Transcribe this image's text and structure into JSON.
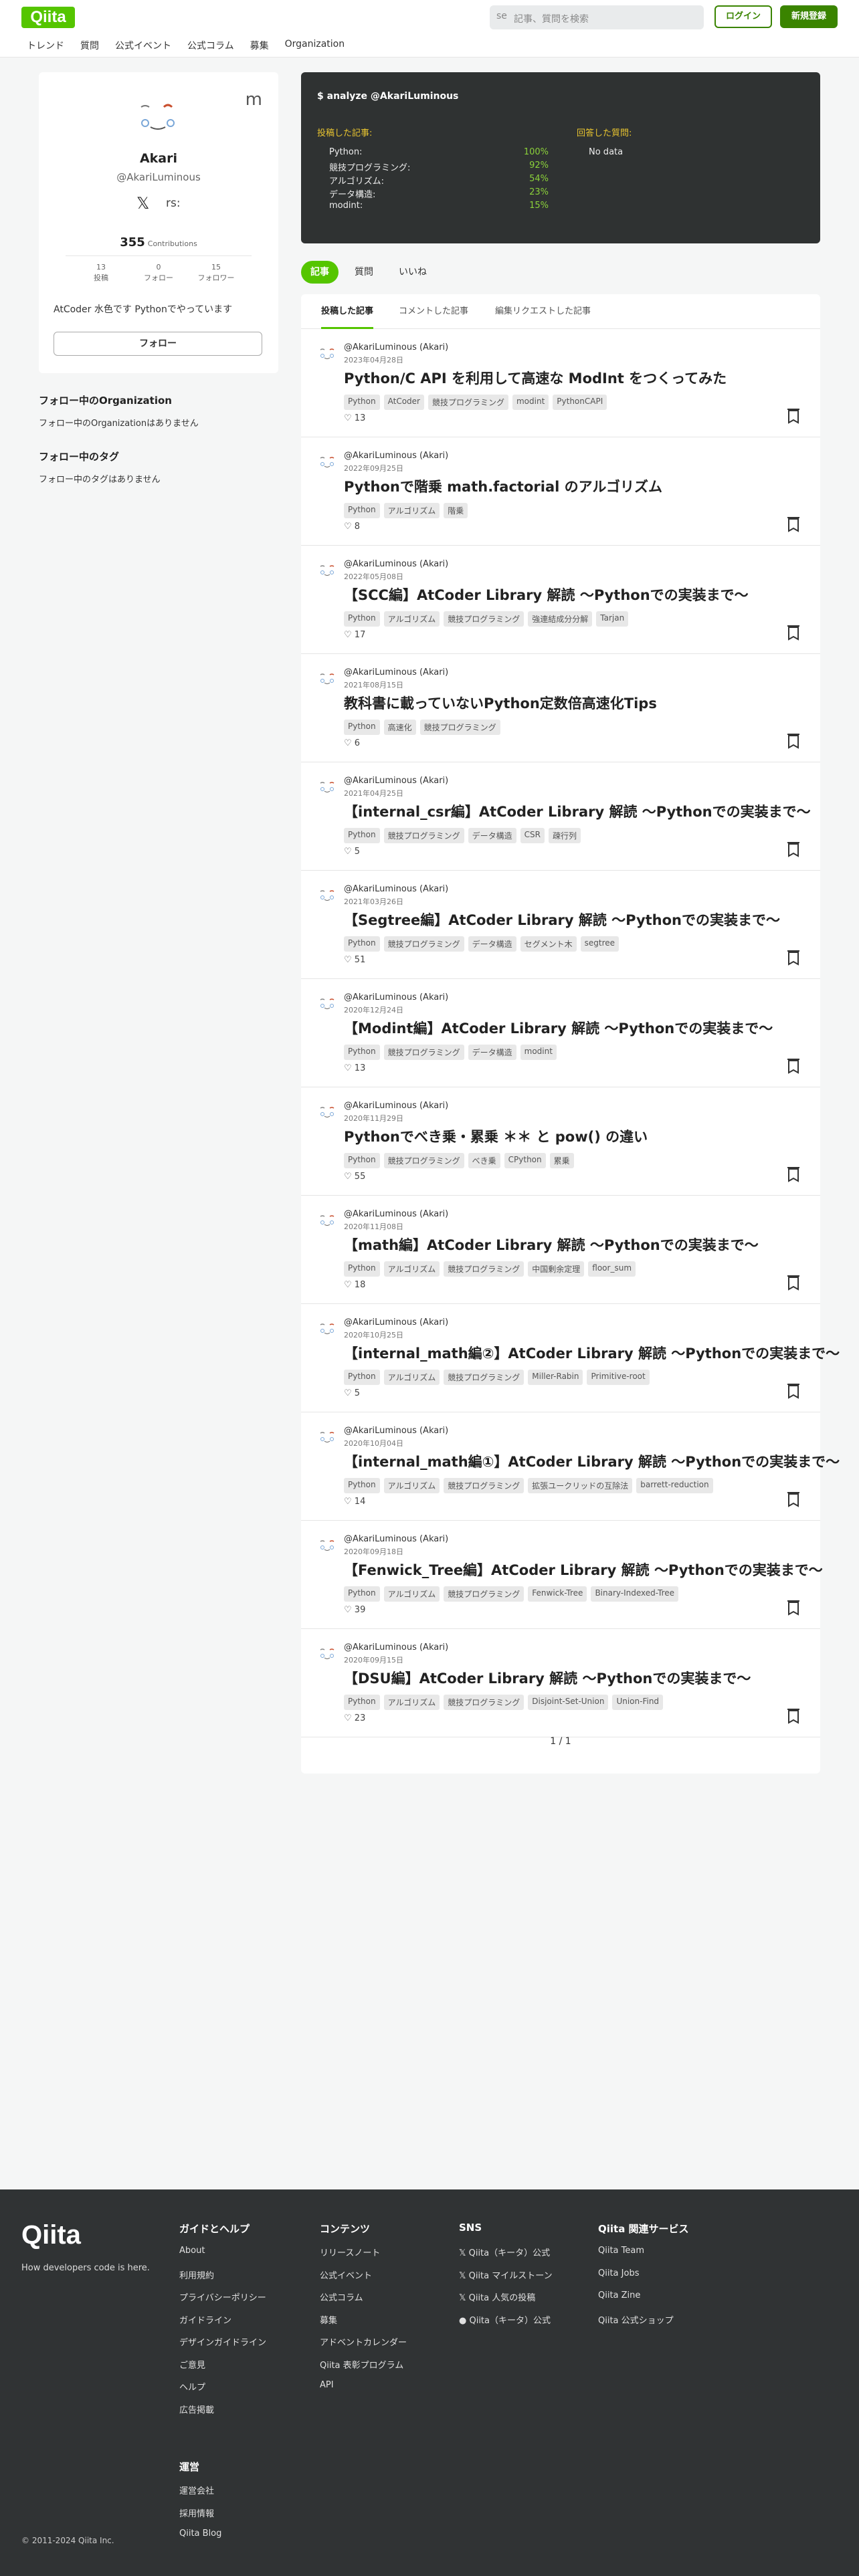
{
  "header": {
    "logo": "Qiita",
    "search_icon_glyph": "se",
    "search_placeholder": "記事、質問を検索",
    "login": "ログイン",
    "signup": "新規登録",
    "nav": [
      "トレンド",
      "質問",
      "公式イベント",
      "公式コラム",
      "募集",
      "Organization"
    ]
  },
  "profile": {
    "m_glyph": "m",
    "name": "Akari",
    "handle": "@AkariLuminous",
    "x_glyph": "𝕏",
    "rss_glyph": "rs:",
    "contributions": "355",
    "contributions_label": "Contributions",
    "stats": [
      {
        "value": "13",
        "label": "投稿"
      },
      {
        "value": "0",
        "label": "フォロー"
      },
      {
        "value": "15",
        "label": "フォロワー"
      }
    ],
    "bio": "AtCoder 水色です Pythonでやっています",
    "follow": "フォロー"
  },
  "sidebar": {
    "org_heading": "フォロー中のOrganization",
    "org_empty": "フォロー中のOrganizationはありません",
    "tag_heading": "フォロー中のタグ",
    "tag_empty": "フォロー中のタグはありません"
  },
  "analyze": {
    "title": "$ analyze @AkariLuminous",
    "posted_heading": "投稿した記事:",
    "answered_heading": "回答した質問:",
    "answered_empty": "No data",
    "rows": [
      {
        "label": "Python:",
        "pct": "100%"
      },
      {
        "label": "競技プログラミング:",
        "pct": "92%"
      },
      {
        "label": "アルゴリズム:",
        "pct": "54%"
      },
      {
        "label": "データ構造:",
        "pct": "23%"
      },
      {
        "label": "modint:",
        "pct": "15%"
      }
    ]
  },
  "tabs": [
    "記事",
    "質問",
    "いいね"
  ],
  "subtabs": [
    "投稿した記事",
    "コメントした記事",
    "編集リクエストした記事"
  ],
  "articles": [
    {
      "author": "@AkariLuminous (Akari)",
      "date": "2023年04月28日",
      "title": "Python/C API を利用して高速な ModInt をつくってみた",
      "tags": [
        "Python",
        "AtCoder",
        "競技プログラミング",
        "modint",
        "PythonCAPI"
      ],
      "likes": "13"
    },
    {
      "author": "@AkariLuminous (Akari)",
      "date": "2022年09月25日",
      "title": "Pythonで階乗 math.factorial のアルゴリズム",
      "tags": [
        "Python",
        "アルゴリズム",
        "階乗"
      ],
      "likes": "8"
    },
    {
      "author": "@AkariLuminous (Akari)",
      "date": "2022年05月08日",
      "title": "【SCC編】AtCoder Library 解読 〜Pythonでの実装まで〜",
      "tags": [
        "Python",
        "アルゴリズム",
        "競技プログラミング",
        "強連結成分分解",
        "Tarjan"
      ],
      "likes": "17"
    },
    {
      "author": "@AkariLuminous (Akari)",
      "date": "2021年08月15日",
      "title": "教科書に載っていないPython定数倍高速化Tips",
      "tags": [
        "Python",
        "高速化",
        "競技プログラミング"
      ],
      "likes": "6"
    },
    {
      "author": "@AkariLuminous (Akari)",
      "date": "2021年04月25日",
      "title": "【internal_csr編】AtCoder Library 解読 〜Pythonでの実装まで〜",
      "tags": [
        "Python",
        "競技プログラミング",
        "データ構造",
        "CSR",
        "疎行列"
      ],
      "likes": "5"
    },
    {
      "author": "@AkariLuminous (Akari)",
      "date": "2021年03月26日",
      "title": "【Segtree編】AtCoder Library 解読 〜Pythonでの実装まで〜",
      "tags": [
        "Python",
        "競技プログラミング",
        "データ構造",
        "セグメント木",
        "segtree"
      ],
      "likes": "51"
    },
    {
      "author": "@AkariLuminous (Akari)",
      "date": "2020年12月24日",
      "title": "【Modint編】AtCoder Library 解読 〜Pythonでの実装まで〜",
      "tags": [
        "Python",
        "競技プログラミング",
        "データ構造",
        "modint"
      ],
      "likes": "13"
    },
    {
      "author": "@AkariLuminous (Akari)",
      "date": "2020年11月29日",
      "title": "Pythonでべき乗・累乗 ＊＊ と pow() の違い",
      "tags": [
        "Python",
        "競技プログラミング",
        "べき乗",
        "CPython",
        "累乗"
      ],
      "likes": "55"
    },
    {
      "author": "@AkariLuminous (Akari)",
      "date": "2020年11月08日",
      "title": "【math編】AtCoder Library 解読 〜Pythonでの実装まで〜",
      "tags": [
        "Python",
        "アルゴリズム",
        "競技プログラミング",
        "中国剰余定理",
        "floor_sum"
      ],
      "likes": "18"
    },
    {
      "author": "@AkariLuminous (Akari)",
      "date": "2020年10月25日",
      "title": "【internal_math編②】AtCoder Library 解読 〜Pythonでの実装まで〜",
      "tags": [
        "Python",
        "アルゴリズム",
        "競技プログラミング",
        "Miller-Rabin",
        "Primitive-root"
      ],
      "likes": "5"
    },
    {
      "author": "@AkariLuminous (Akari)",
      "date": "2020年10月04日",
      "title": "【internal_math編①】AtCoder Library 解読 〜Pythonでの実装まで〜",
      "tags": [
        "Python",
        "アルゴリズム",
        "競技プログラミング",
        "拡張ユークリッドの互除法",
        "barrett-reduction"
      ],
      "likes": "14"
    },
    {
      "author": "@AkariLuminous (Akari)",
      "date": "2020年09月18日",
      "title": "【Fenwick_Tree編】AtCoder Library 解読 〜Pythonでの実装まで〜",
      "tags": [
        "Python",
        "アルゴリズム",
        "競技プログラミング",
        "Fenwick-Tree",
        "Binary-Indexed-Tree"
      ],
      "likes": "39"
    },
    {
      "author": "@AkariLuminous (Akari)",
      "date": "2020年09月15日",
      "title": "【DSU編】AtCoder Library 解読 〜Pythonでの実装まで〜",
      "tags": [
        "Python",
        "アルゴリズム",
        "競技プログラミング",
        "Disjoint-Set-Union",
        "Union-Find"
      ],
      "likes": "23"
    }
  ],
  "pager": "1 / 1",
  "footer": {
    "logo": "Qiita",
    "tagline": "How developers code is here.",
    "copyright": "© 2011-2024 Qiita Inc.",
    "guide": {
      "heading": "ガイドとヘルプ",
      "links": [
        "About",
        "利用規約",
        "プライバシーポリシー",
        "ガイドライン",
        "デザインガイドライン",
        "ご意見",
        "ヘルプ",
        "広告掲載"
      ]
    },
    "contents": {
      "heading": "コンテンツ",
      "links": [
        "リリースノート",
        "公式イベント",
        "公式コラム",
        "募集",
        "アドベントカレンダー",
        "Qiita 表彰プログラム",
        "API"
      ]
    },
    "sns": {
      "heading": "SNS",
      "links": [
        "𝕏 Qiita（キータ）公式",
        "𝕏 Qiita マイルストーン",
        "𝕏 Qiita 人気の投稿",
        "● Qiita（キータ）公式"
      ]
    },
    "services": {
      "heading": "Qiita 関連サービス",
      "links": [
        "Qiita Team",
        "Qiita Jobs",
        "Qiita Zine",
        "Qiita 公式ショップ"
      ]
    },
    "company": {
      "heading": "運営",
      "links": [
        "運営会社",
        "採用情報",
        "Qiita Blog"
      ]
    }
  },
  "colors": {
    "brand": "#55c500",
    "brand_dark": "#3a8400",
    "analyze_bg": "#2f3232",
    "footer_bg": "#303334"
  }
}
